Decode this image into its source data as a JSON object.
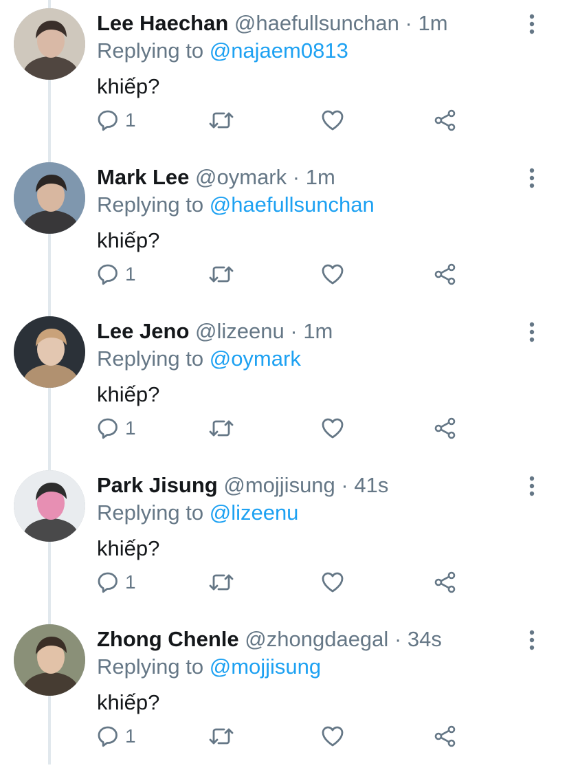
{
  "tweets": [
    {
      "name": "Lee Haechan",
      "handle": "@haefullsunchan",
      "separator": "·",
      "time": "1m",
      "replying_prefix": "Replying to",
      "replying_to": "@najaem0813",
      "text": "khiếp?",
      "reply_count": "1",
      "avatar_colors": [
        "#cfc8bd",
        "#3a2f2a",
        "#d9b9a6"
      ]
    },
    {
      "name": "Mark Lee",
      "handle": "@oymark",
      "separator": "·",
      "time": "1m",
      "replying_prefix": "Replying to",
      "replying_to": "@haefullsunchan",
      "text": "khiếp?",
      "reply_count": "1",
      "avatar_colors": [
        "#7f97ae",
        "#2b2624",
        "#d8b7a0"
      ]
    },
    {
      "name": "Lee Jeno",
      "handle": "@lizeenu",
      "separator": "·",
      "time": "1m",
      "replying_prefix": "Replying to",
      "replying_to": "@oymark",
      "text": "khiếp?",
      "reply_count": "1",
      "avatar_colors": [
        "#2b3138",
        "#c9a27a",
        "#e3c7b1"
      ]
    },
    {
      "name": "Park Jisung",
      "handle": "@mojjisung",
      "separator": "·",
      "time": "41s",
      "replying_prefix": "Replying to",
      "replying_to": "@lizeenu",
      "text": "khiếp?",
      "reply_count": "1",
      "avatar_colors": [
        "#e9ecef",
        "#2d2d2d",
        "#e78fb3"
      ]
    },
    {
      "name": "Zhong Chenle",
      "handle": "@zhongdaegal",
      "separator": "·",
      "time": "34s",
      "replying_prefix": "Replying to",
      "replying_to": "@mojjisung",
      "text": "khiếp?",
      "reply_count": "1",
      "avatar_colors": [
        "#8a9078",
        "#3a2e26",
        "#e2c2a8"
      ]
    }
  ],
  "icons": {
    "reply": "reply-icon",
    "retweet": "retweet-icon",
    "like": "heart-icon",
    "share": "share-icon",
    "more": "more-vertical-icon"
  },
  "colors": {
    "name": "#14171a",
    "secondary": "#657786",
    "mention": "#1da1f2",
    "thread_line": "#e1e8ed"
  }
}
